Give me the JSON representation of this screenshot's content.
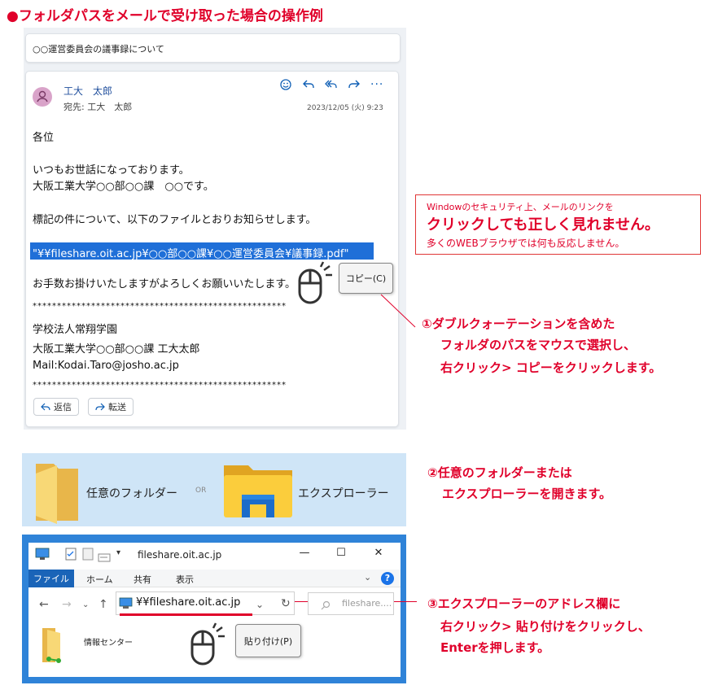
{
  "title": "●フォルダパスをメールで受け取った場合の操作例",
  "mail": {
    "subject": "○○運営委員会の議事録について",
    "sender": "工大　太郎",
    "to": "宛先: 工大　太郎",
    "date": "2023/12/05 (火) 9:23",
    "body": {
      "greet": "各位",
      "l1": "いつもお世話になっております。",
      "l2": "大阪工業大学○○部○○課　○○です。",
      "l3": "標記の件について、以下のファイルとおりお知らせします。",
      "path": "\"¥¥fileshare.oit.ac.jp¥○○部○○課¥○○運営委員会¥議事録.pdf\"",
      "l4": "お手数お掛けいたしますがよろしくお願いいたします。",
      "stars": "****************************************************",
      "sig1": "学校法人常翔学園",
      "sig2": "大阪工業大学○○部○○課 工大太郎",
      "sig3": "Mail:Kodai.Taro@josho.ac.jp"
    },
    "reply_label": "返信",
    "forward_label": "転送",
    "copy_menu": "コピー(C)"
  },
  "warning": {
    "line1": "Windowのセキュリティ上、メールのリンクを",
    "line2": "クリックしても正しく見れません。",
    "line3": "多くのWEBブラウザでは何も反応しません。"
  },
  "step1": [
    "①ダブルクォーテーションを含めた",
    "フォルダのパスをマウスで選択し、",
    "右クリック> コピーをクリックします。"
  ],
  "step2": [
    "②任意のフォルダーまたは",
    "エクスプローラーを開きます。"
  ],
  "step3": [
    "③エクスプローラーのアドレス欄に",
    "右クリック> 貼り付けをクリックし、",
    "Enterを押します。"
  ],
  "folders": {
    "folder_label": "任意のフォルダー",
    "or_label": "OR",
    "explorer_label": "エクスプローラー"
  },
  "explorer": {
    "window_title": "fileshare.oit.ac.jp",
    "tabs": [
      "ファイル",
      "ホーム",
      "共有",
      "表示"
    ],
    "address": "¥¥fileshare.oit.ac.jp",
    "search_placeholder": "fileshare....",
    "item_label": "情報センター",
    "paste_menu": "貼り付け(P)"
  },
  "colors": {
    "accent_red": "#e0002a",
    "explorer_blue": "#2f83d8",
    "selection_blue": "#1f6fd8"
  }
}
